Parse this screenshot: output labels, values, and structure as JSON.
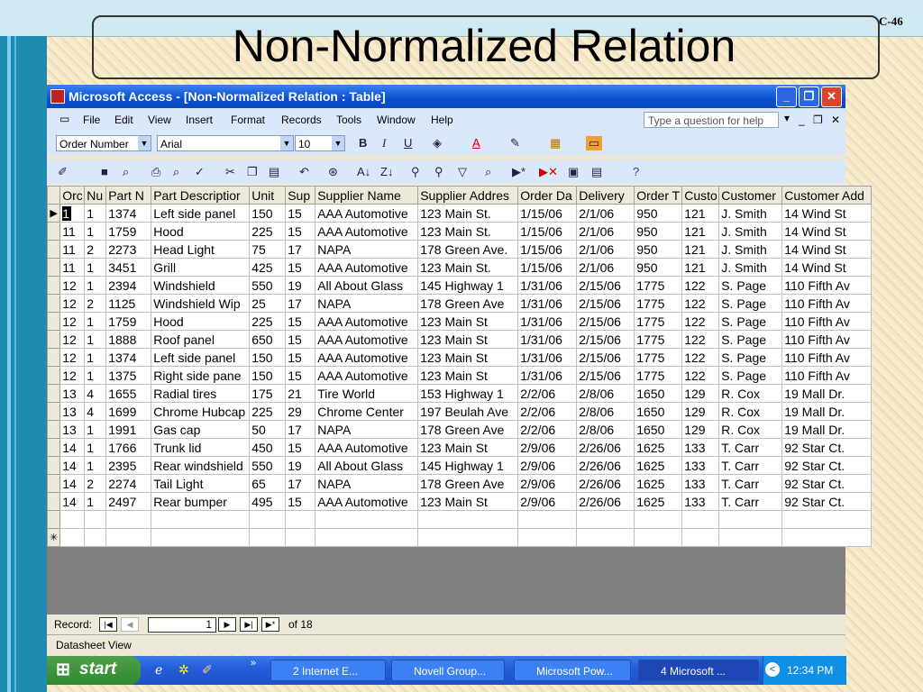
{
  "slide": {
    "title": "Non-Normalized Relation",
    "number": "C-46"
  },
  "window": {
    "title": "Microsoft Access - [Non-Normalized Relation : Table]",
    "menu": [
      "File",
      "Edit",
      "View",
      "Insert",
      "Format",
      "Records",
      "Tools",
      "Window",
      "Help"
    ],
    "question_placeholder": "Type a question for help",
    "field_combo": "Order Number",
    "font_combo": "Arial",
    "size_combo": "10"
  },
  "columns": [
    "Orc",
    "Nu",
    "Part N",
    "Part Descriptior",
    "Unit",
    "Sup",
    "Supplier Name",
    "Supplier Addres",
    "Order Da",
    "Delivery",
    "Order T",
    "Custo",
    "Customer",
    "Customer Add"
  ],
  "rows": [
    [
      "1",
      "1",
      "1374",
      "Left side panel",
      "150",
      "15",
      "AAA Automotive",
      "123 Main St.",
      "1/15/06",
      "2/1/06",
      "950",
      "121",
      "J. Smith",
      "14 Wind St"
    ],
    [
      "11",
      "1",
      "1759",
      "Hood",
      "225",
      "15",
      "AAA Automotive",
      "123 Main St.",
      "1/15/06",
      "2/1/06",
      "950",
      "121",
      "J. Smith",
      "14 Wind St"
    ],
    [
      "11",
      "2",
      "2273",
      "Head Light",
      "75",
      "17",
      "NAPA",
      "178 Green Ave.",
      "1/15/06",
      "2/1/06",
      "950",
      "121",
      "J. Smith",
      "14 Wind St"
    ],
    [
      "11",
      "1",
      "3451",
      "Grill",
      "425",
      "15",
      "AAA Automotive",
      "123 Main St.",
      "1/15/06",
      "2/1/06",
      "950",
      "121",
      "J. Smith",
      "14 Wind St"
    ],
    [
      "12",
      "1",
      "2394",
      "Windshield",
      "550",
      "19",
      "All About Glass",
      "145 Highway 1",
      "1/31/06",
      "2/15/06",
      "1775",
      "122",
      "S. Page",
      "110 Fifth Av"
    ],
    [
      "12",
      "2",
      "1125",
      "Windshield Wip",
      "25",
      "17",
      "NAPA",
      "178 Green Ave",
      "1/31/06",
      "2/15/06",
      "1775",
      "122",
      "S. Page",
      "110 Fifth Av"
    ],
    [
      "12",
      "1",
      "1759",
      "Hood",
      "225",
      "15",
      "AAA Automotive",
      "123 Main St",
      "1/31/06",
      "2/15/06",
      "1775",
      "122",
      "S. Page",
      "110 Fifth Av"
    ],
    [
      "12",
      "1",
      "1888",
      "Roof panel",
      "650",
      "15",
      "AAA Automotive",
      "123 Main St",
      "1/31/06",
      "2/15/06",
      "1775",
      "122",
      "S. Page",
      "110 Fifth Av"
    ],
    [
      "12",
      "1",
      "1374",
      "Left side panel",
      "150",
      "15",
      "AAA Automotive",
      "123 Main St",
      "1/31/06",
      "2/15/06",
      "1775",
      "122",
      "S. Page",
      "110 Fifth Av"
    ],
    [
      "12",
      "1",
      "1375",
      "Right side pane",
      "150",
      "15",
      "AAA Automotive",
      "123 Main St",
      "1/31/06",
      "2/15/06",
      "1775",
      "122",
      "S. Page",
      "110 Fifth Av"
    ],
    [
      "13",
      "4",
      "1655",
      "Radial tires",
      "175",
      "21",
      "Tire World",
      "153 Highway 1",
      "2/2/06",
      "2/8/06",
      "1650",
      "129",
      "R. Cox",
      "19 Mall Dr."
    ],
    [
      "13",
      "4",
      "1699",
      "Chrome Hubcap",
      "225",
      "29",
      "Chrome Center",
      "197 Beulah Ave",
      "2/2/06",
      "2/8/06",
      "1650",
      "129",
      "R. Cox",
      "19 Mall Dr."
    ],
    [
      "13",
      "1",
      "1991",
      "Gas cap",
      "50",
      "17",
      "NAPA",
      "178 Green Ave",
      "2/2/06",
      "2/8/06",
      "1650",
      "129",
      "R. Cox",
      "19 Mall Dr."
    ],
    [
      "14",
      "1",
      "1766",
      "Trunk lid",
      "450",
      "15",
      "AAA Automotive",
      "123 Main St",
      "2/9/06",
      "2/26/06",
      "1625",
      "133",
      "T. Carr",
      "92 Star Ct."
    ],
    [
      "14",
      "1",
      "2395",
      "Rear windshield",
      "550",
      "19",
      "All About Glass",
      "145 Highway 1",
      "2/9/06",
      "2/26/06",
      "1625",
      "133",
      "T. Carr",
      "92 Star Ct."
    ],
    [
      "14",
      "2",
      "2274",
      "Tail Light",
      "65",
      "17",
      "NAPA",
      "178 Green Ave",
      "2/9/06",
      "2/26/06",
      "1625",
      "133",
      "T. Carr",
      "92 Star Ct."
    ],
    [
      "14",
      "1",
      "2497",
      "Rear bumper",
      "495",
      "15",
      "AAA Automotive",
      "123 Main St",
      "2/9/06",
      "2/26/06",
      "1625",
      "133",
      "T. Carr",
      "92 Star Ct."
    ]
  ],
  "navigation": {
    "label": "Record:",
    "current": "1",
    "of": "of 18"
  },
  "status": "Datasheet View",
  "taskbar": {
    "start": "start",
    "items": [
      "2 Internet E...",
      "Novell Group...",
      "Microsoft Pow...",
      "4 Microsoft ..."
    ],
    "clock": "12:34 PM"
  }
}
